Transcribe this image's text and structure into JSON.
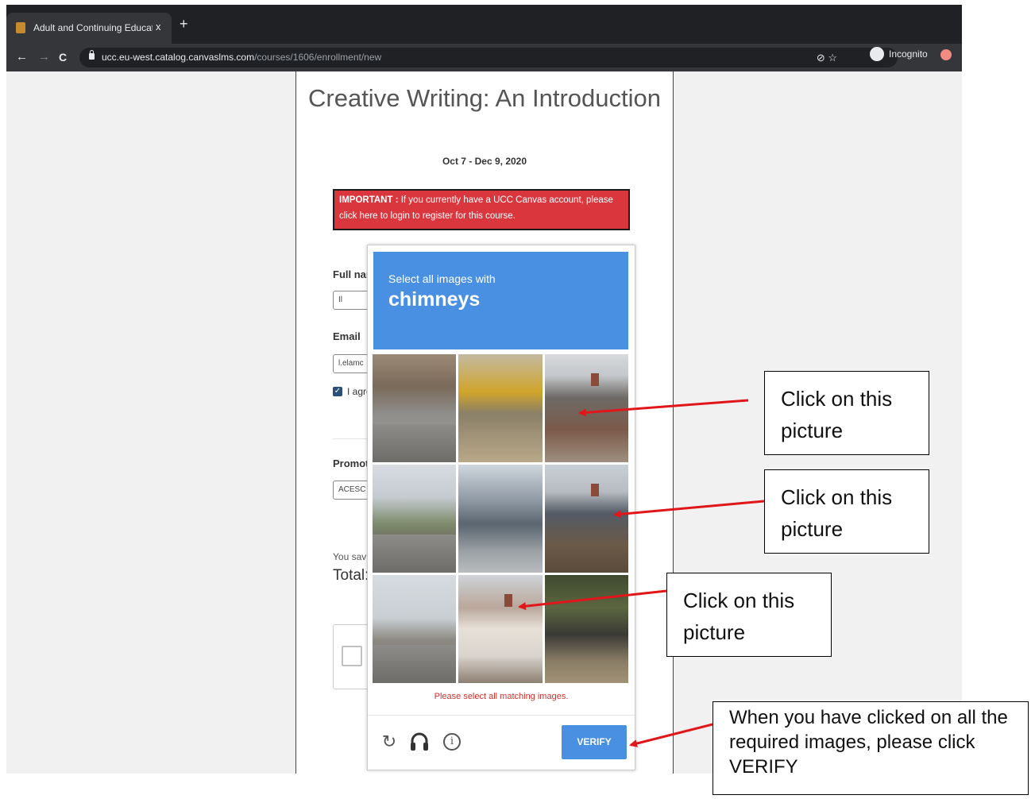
{
  "browser": {
    "tab_title": "Adult and Continuing Educatio",
    "tab_close": "x",
    "new_tab": "+",
    "url_host": "ucc.eu-west.catalog.canvaslms.com",
    "url_path": "/courses/1606/enrollment/new",
    "incognito_label": "Incognito",
    "nav_back": "←",
    "nav_forward": "→",
    "nav_reload": "C",
    "omni_icons": "⊘  ☆"
  },
  "page": {
    "title": "Creative Writing: An Introduction",
    "dates": "Oct 7 - Dec 9, 2020",
    "important_label": "IMPORTANT :",
    "important_text": " If you currently have a UCC Canvas account, please click here to login to register for this course.",
    "full_name_label": "Full nar",
    "full_name_value": "Il",
    "email_label": "Email",
    "email_value": "l.elamc",
    "agree_label": "I agre",
    "promo_label": "Promot",
    "promo_value": "ACESC",
    "savings_text": "You sav",
    "total_label": "Total:"
  },
  "captcha": {
    "prompt_line1": "Select all images with",
    "prompt_line2": "chimneys",
    "error_text": "Please select all matching images.",
    "verify_label": "VERIFY",
    "reload_icon": "↻",
    "audio_icon": "🎧",
    "info_icon": "i"
  },
  "callouts": [
    {
      "text": "Click on this picture"
    },
    {
      "text": "Click on this picture"
    },
    {
      "text": "Click on this picture"
    },
    {
      "text": "When you have clicked on all the required images, please click VERIFY"
    }
  ],
  "colors": {
    "captcha_blue": "#4a90e2",
    "important_red": "#d9363e",
    "arrow_red": "#e0161b"
  }
}
